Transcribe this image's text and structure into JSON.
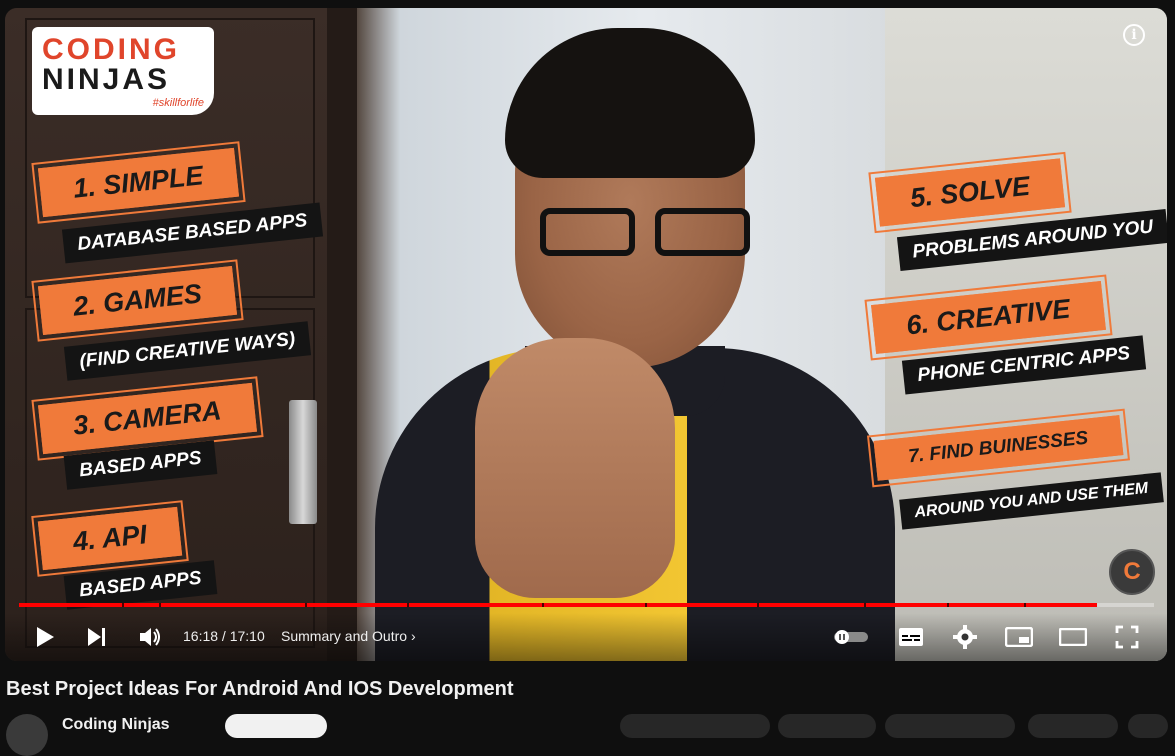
{
  "logo": {
    "line1": "CODING",
    "line2": "NINJAS",
    "tagline": "#skillforlife"
  },
  "overlay_left": [
    {
      "orange": "1. SIMPLE",
      "black": "DATABASE BASED APPS"
    },
    {
      "orange": "2. GAMES",
      "black": "(FIND CREATIVE WAYS)"
    },
    {
      "orange": "3. CAMERA",
      "black": "BASED APPS"
    },
    {
      "orange": "4. API",
      "black": "BASED APPS"
    }
  ],
  "overlay_right": [
    {
      "orange": "5. SOLVE",
      "black": "PROBLEMS AROUND YOU"
    },
    {
      "orange": "6. CREATIVE",
      "black": "PHONE CENTRIC APPS"
    },
    {
      "orange": "7. FIND BUINESSES",
      "black": "AROUND YOU AND USE THEM"
    }
  ],
  "player": {
    "current_time": "16:18",
    "duration": "17:10",
    "time_display": "16:18 / 17:10",
    "chapter": "Summary and Outro",
    "progress_fraction": 0.95,
    "accent_color": "#ff0000",
    "icons": [
      "play-icon",
      "next-icon",
      "volume-icon",
      "autoplay-toggle-icon",
      "subtitles-icon",
      "settings-icon",
      "miniplayer-icon",
      "theater-icon",
      "fullscreen-icon",
      "info-icon"
    ]
  },
  "video": {
    "title": "Best Project Ideas For Android And IOS Development"
  },
  "channel": {
    "name": "Coding Ninjas"
  }
}
